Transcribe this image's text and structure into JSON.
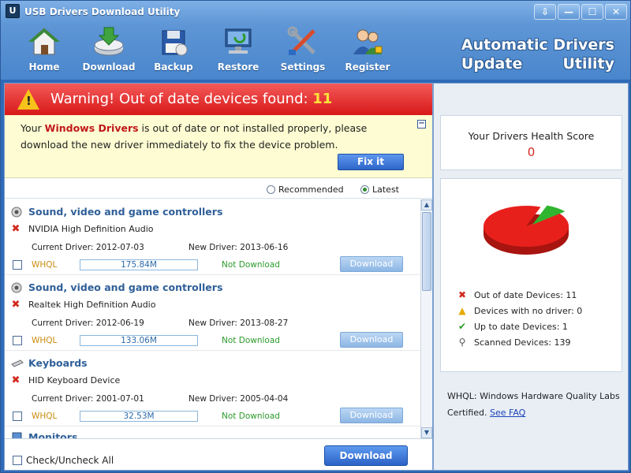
{
  "window": {
    "title": "USB Drivers Download Utility",
    "controls": [
      "⇩",
      "—",
      "☐",
      "✕"
    ]
  },
  "toolbar": {
    "items": [
      {
        "label": "Home",
        "icon": "home-icon"
      },
      {
        "label": "Download",
        "icon": "download-icon"
      },
      {
        "label": "Backup",
        "icon": "backup-icon"
      },
      {
        "label": "Restore",
        "icon": "restore-icon"
      },
      {
        "label": "Settings",
        "icon": "settings-icon"
      },
      {
        "label": "Register",
        "icon": "register-icon"
      }
    ],
    "brand_line1": "Automatic Drivers",
    "brand_line2a": "Update",
    "brand_line2b": "Utility"
  },
  "warning": {
    "text": "Warning! Out of date devices found: ",
    "count": "11"
  },
  "notice": {
    "part1": "Your ",
    "highlight": "Windows Drivers",
    "part2": "  is out of date or not installed properly, please download the new driver immediately to fix the device problem.",
    "fix_label": "Fix it",
    "collapse": "−"
  },
  "options": {
    "recommended": "Recommended",
    "latest": "Latest",
    "selected": "Latest"
  },
  "drivers": [
    {
      "category": "Sound, video and game controllers",
      "device": "NVIDIA High Definition Audio",
      "current": "Current Driver: 2012-07-03",
      "new": "New Driver: 2013-06-16",
      "whql": "WHQL",
      "size": "175.84M",
      "status": "Not Download",
      "button": "Download"
    },
    {
      "category": "Sound, video and game controllers",
      "device": "Realtek High Definition Audio",
      "current": "Current Driver: 2012-06-19",
      "new": "New Driver: 2013-08-27",
      "whql": "WHQL",
      "size": "133.06M",
      "status": "Not Download",
      "button": "Download"
    },
    {
      "category": "Keyboards",
      "device": "HID Keyboard Device",
      "current": "Current Driver: 2001-07-01",
      "new": "New Driver: 2005-04-04",
      "whql": "WHQL",
      "size": "32.53M",
      "status": "Not Download",
      "button": "Download"
    }
  ],
  "partial_category": "Monitors",
  "bottom": {
    "check_all": "Check/Uncheck All",
    "download": "Download"
  },
  "health": {
    "label": "Your Drivers Health Score",
    "score": "0"
  },
  "stats": {
    "out_of_date": "Out of date Devices: 11",
    "no_driver": "Devices with no driver: 0",
    "up_to_date": "Up to date Devices: 1",
    "scanned": "Scanned Devices: 139"
  },
  "pie_data": {
    "out_of_date": 11,
    "up_to_date": 1,
    "colors": {
      "out_of_date": "#e8201c",
      "up_to_date": "#2fb52f"
    }
  },
  "whql_note": {
    "text": "WHQL: Windows Hardware Quality Labs Certified. ",
    "link": "See FAQ"
  }
}
